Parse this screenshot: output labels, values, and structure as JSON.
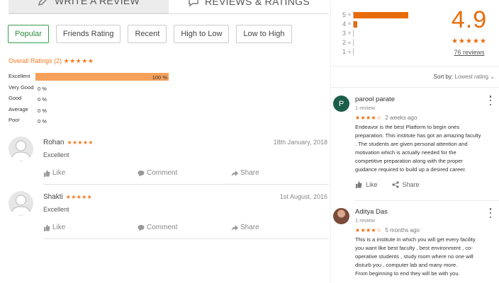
{
  "tabs": {
    "write_label": "WRITE A REVIEW",
    "reviews_label": "REVIEWS & RATINGS"
  },
  "filters": [
    {
      "label": "Popular",
      "active": true
    },
    {
      "label": "Friends Rating",
      "active": false
    },
    {
      "label": "Recent",
      "active": false
    },
    {
      "label": "High to Low",
      "active": false
    },
    {
      "label": "Low to High",
      "active": false
    }
  ],
  "overall": {
    "label": "Overall Ratings (2)",
    "stars": "★★★★★"
  },
  "rating_breakdown": [
    {
      "label": "Excellent",
      "percent": 100,
      "pct_text": "100 %"
    },
    {
      "label": "Very Good",
      "percent": 0,
      "pct_text": "0 %"
    },
    {
      "label": "Good",
      "percent": 0,
      "pct_text": "0 %"
    },
    {
      "label": "Average",
      "percent": 0,
      "pct_text": "0 %"
    },
    {
      "label": "Poor",
      "percent": 0,
      "pct_text": "0 %"
    }
  ],
  "reviews": [
    {
      "name": "Rohan",
      "stars": "★★★★★",
      "date": "18th January, 2018",
      "text": "Excellent",
      "like": "Like",
      "comment": "Comment",
      "share": "Share"
    },
    {
      "name": "Shakti",
      "stars": "★★★★★",
      "date": "1st August, 2016",
      "text": "Excellent",
      "like": "Like",
      "comment": "Comment",
      "share": "Share"
    }
  ],
  "google": {
    "distribution": [
      {
        "star": "5",
        "fraction": 0.64
      },
      {
        "star": "4",
        "fraction": 0.04
      },
      {
        "star": "3",
        "fraction": 0.0
      },
      {
        "star": "2",
        "fraction": 0.0
      },
      {
        "star": "1",
        "fraction": 0.0
      }
    ],
    "score": "4.9",
    "stars": "★★★★★",
    "review_count": "76 reviews",
    "sort_label": "Sort by:",
    "sort_value": "Lowest rating",
    "reviews": [
      {
        "initial": "P",
        "avatar_color": "#1b5e4a",
        "name": "parool parate",
        "sub": "1 review",
        "stars": "★★★★☆",
        "ago": "2 weeks ago",
        "text": "Endeavor is the best Platform to begin ones\npreparation. This institute has got an amazing faculty\n. The students are given personal attention and\nmotivation which is actually needed for the\ncompetitive preparation along with the proper\nguidance required to build up a desired career.",
        "like": "Like",
        "share": "Share"
      },
      {
        "initial": "",
        "avatar_color": "#7a4b3a",
        "name": "Aditya Das",
        "sub": "1 review",
        "stars": "★★★★☆",
        "ago": "5 months ago",
        "text": "This is a institute in which you will get every facility\nyou want like best faculty , best environment , co-\noperative students , study room where no one will\ndisturb you , computer lab and many more.\nFrom beginning to end they will be with you.",
        "like": "",
        "share": ""
      }
    ]
  },
  "colors": {
    "accent_orange": "#f47b20",
    "google_orange": "#e86c0c",
    "bar_fill": "#f7a05a",
    "active_green": "#3a9d4a"
  }
}
